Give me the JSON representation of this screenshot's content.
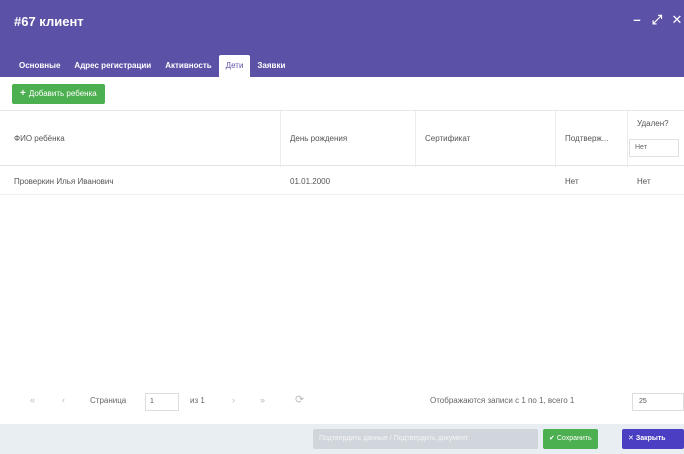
{
  "window": {
    "title": "#67 клиент"
  },
  "controls": {
    "minimize": "–",
    "maximize": "⤢",
    "close": "✕"
  },
  "tabs": [
    {
      "label": "Основные"
    },
    {
      "label": "Адрес регистрации"
    },
    {
      "label": "Активность"
    },
    {
      "label": "Дети",
      "active": true
    },
    {
      "label": "Заявки"
    }
  ],
  "toolbar": {
    "add_label": "Добавить ребенка",
    "plus": "+"
  },
  "grid": {
    "columns": [
      "ФИО ребёнка",
      "День рождения",
      "Сертификат",
      "Подтверж...",
      "Удален?"
    ],
    "deleted_filter": "Нет",
    "rows": [
      {
        "name": "Проверкин Илья Иванович",
        "birthday": "01.01.2000",
        "certificate": "",
        "confirmed": "Нет",
        "deleted": "Нет"
      }
    ]
  },
  "pager": {
    "first": "«",
    "prev": "‹",
    "page_label": "Страница",
    "page": "1",
    "of": "из 1",
    "next": "›",
    "last": "»",
    "refresh": "⟳",
    "status": "Отображаются записи с 1 по 1, всего 1",
    "page_size": "25"
  },
  "footer": {
    "disabled_label": "Подтвердить данные / Подтвердить документ",
    "save_label": "Сохранить",
    "close_label": "Закрыть",
    "check": "✔",
    "x": "✕"
  },
  "colors": {
    "header": "#5b51a6",
    "add": "#4caf50",
    "close": "#4a3fc2"
  }
}
